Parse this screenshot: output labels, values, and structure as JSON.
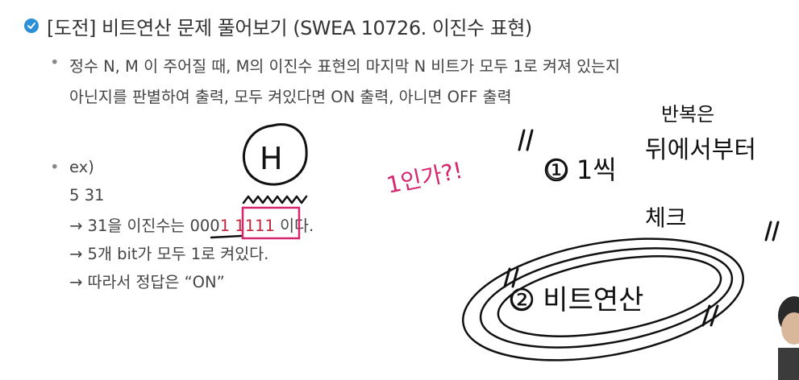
{
  "slide": {
    "title": "[도전] 비트연산 문제 풀어보기 (SWEA 10726. 이진수 표현)",
    "bullets": [
      {
        "lines": [
          "정수 N, M 이 주어질 때, M의 이진수 표현의 마지막 N 비트가 모두 1로 켜져 있는지",
          "아닌지를 판별하여 출력, 모두 켜있다면 ON 출력, 아니면 OFF 출력"
        ]
      },
      {
        "lines": [
          "ex)",
          "5 31"
        ]
      }
    ],
    "example": {
      "line1_prefix": "→ 31을 이진수는 ",
      "line1_gray": "000",
      "line1_red": "1 1111",
      "line1_suffix": " 이다.",
      "line2": "→ 5개 bit가 모두 1로 켜있다.",
      "line3": "→ 따라서 정답은 “ON”"
    }
  },
  "annotations": {
    "circled_letter": "H",
    "note_pink": "1인가?!",
    "note_right_top": "반복은",
    "note_right_top2": "뒤에서부터",
    "note_step1": "① 1씩",
    "note_check": "체크",
    "note_step2": "② 비트연산",
    "ink_color": "#111111",
    "highlight_color": "#d6246e"
  },
  "colors": {
    "check_badge": "#2d8fd6",
    "red_digits": "#c0263b",
    "text": "#444444"
  }
}
